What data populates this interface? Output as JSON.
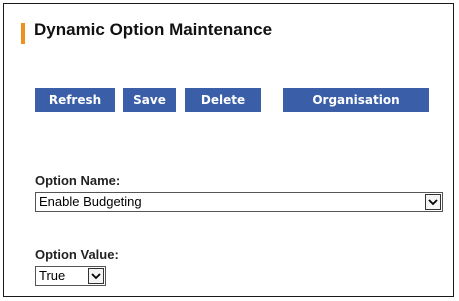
{
  "page": {
    "title": "Dynamic Option Maintenance"
  },
  "toolbar": {
    "refresh_label": "Refresh",
    "save_label": "Save",
    "delete_label": "Delete",
    "organisation_label": "Organisation"
  },
  "form": {
    "option_name_label": "Option Name:",
    "option_name_value": "Enable Budgeting",
    "option_value_label": "Option Value:",
    "option_value_value": "True"
  },
  "colors": {
    "accent": "#f0901e",
    "button_bg": "#3a5ea8",
    "button_text": "#ffffff"
  },
  "icons": {
    "dropdown": "chevron-down-icon"
  }
}
